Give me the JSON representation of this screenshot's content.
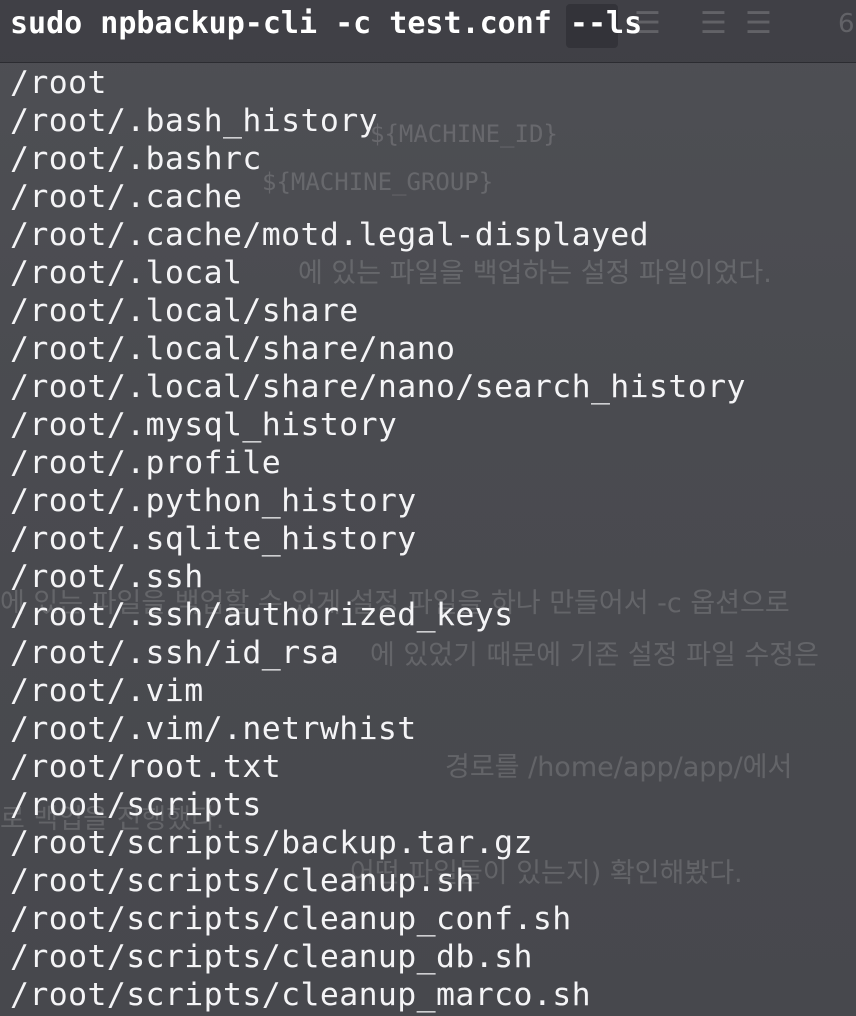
{
  "command": "sudo npbackup-cli -c test.conf --ls",
  "output_lines": [
    "/root",
    "/root/.bash_history",
    "/root/.bashrc",
    "/root/.cache",
    "/root/.cache/motd.legal-displayed",
    "/root/.local",
    "/root/.local/share",
    "/root/.local/share/nano",
    "/root/.local/share/nano/search_history",
    "/root/.mysql_history",
    "/root/.profile",
    "/root/.python_history",
    "/root/.sqlite_history",
    "/root/.ssh",
    "/root/.ssh/authorized_keys",
    "/root/.ssh/id_rsa",
    "/root/.vim",
    "/root/.vim/.netrwhist",
    "/root/root.txt",
    "/root/scripts",
    "/root/scripts/backup.tar.gz",
    "/root/scripts/cleanup.sh",
    "/root/scripts/cleanup_conf.sh",
    "/root/scripts/cleanup_db.sh",
    "/root/scripts/cleanup_marco.sh"
  ],
  "background_text": {
    "line_1": "${MACHINE_ID}",
    "line_2": "${MACHINE_GROUP}",
    "line_3": "에 있는 파일을 백업하는 설정 파일이었다.",
    "line_4": "에 있는 파일을 백업할 수 있게 설정 파일을 하나 만들어서 -c 옵션으로",
    "line_5": "에 있었기 때문에 기존 설정 파일 수정은 ",
    "line_6": "로 백업을 진행했다.",
    "line_7": "경로를 /home/app/app/에서",
    "line_8": "어떤 파일들이 있는지) 확인해봤다."
  },
  "toolbar": {
    "page_number": "6"
  },
  "colors": {
    "background": "#4a4b50",
    "text": "#f4f4f6",
    "command_text": "#ffffff"
  }
}
